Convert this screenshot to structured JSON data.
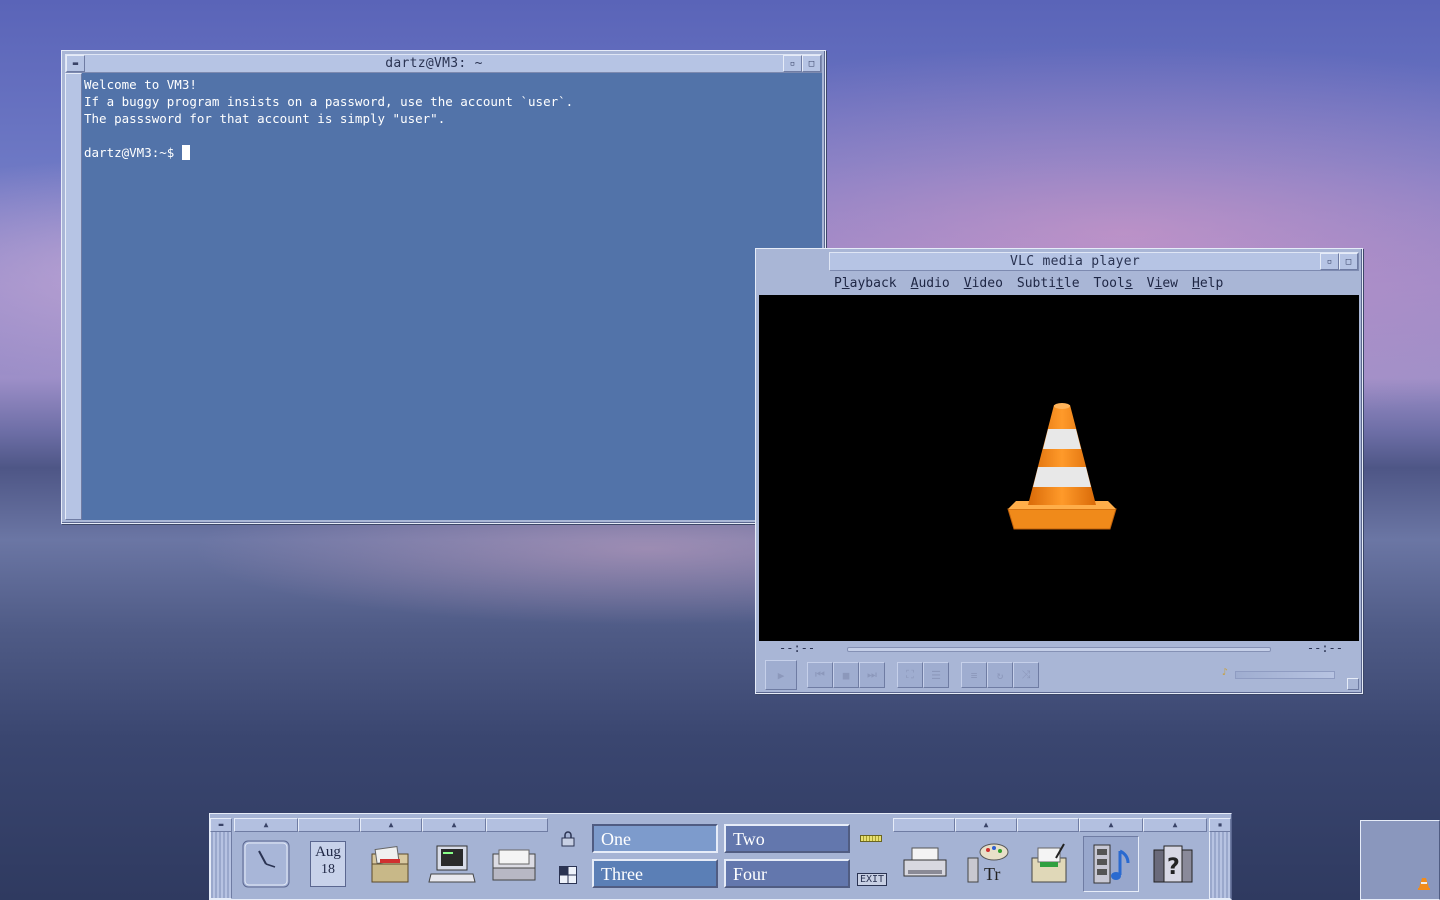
{
  "terminal": {
    "title": "dartz@VM3: ~",
    "lines": [
      "Welcome to VM3!",
      "If a buggy program insists on a password, use the account `user`.",
      "The passsword for that account is simply \"user\".",
      "",
      "dartz@VM3:~$ "
    ]
  },
  "vlc": {
    "title": "VLC media player",
    "menu": [
      {
        "pre": "P",
        "ul": "l",
        "post": "ayback"
      },
      {
        "pre": "",
        "ul": "A",
        "post": "udio"
      },
      {
        "pre": "",
        "ul": "V",
        "post": "ideo"
      },
      {
        "pre": "Subti",
        "ul": "t",
        "post": "le"
      },
      {
        "pre": "Tool",
        "ul": "s",
        "post": ""
      },
      {
        "pre": "V",
        "ul": "i",
        "post": "ew"
      },
      {
        "pre": "",
        "ul": "H",
        "post": "elp"
      }
    ],
    "time_elapsed": "--:--",
    "time_total": "--:--",
    "accent": "#f28c1c"
  },
  "panel": {
    "calendar": {
      "month": "Aug",
      "day": "18"
    },
    "workspaces": {
      "one": "One",
      "two": "Two",
      "three": "Three",
      "four": "Four"
    },
    "exit_label": "EXIT",
    "icons": {
      "clock": "clock-icon",
      "calendar": "calendar-icon",
      "files": "file-manager-icon",
      "terminal": "computer-icon",
      "mail": "mailer-icon",
      "printer": "printer-icon",
      "style": "style-manager-icon",
      "editor": "text-editor-icon",
      "media": "media-player-icon",
      "help": "help-books-icon"
    }
  },
  "colors": {
    "terminal_bg": "#5273a9",
    "chrome": "#a9b6d6"
  }
}
